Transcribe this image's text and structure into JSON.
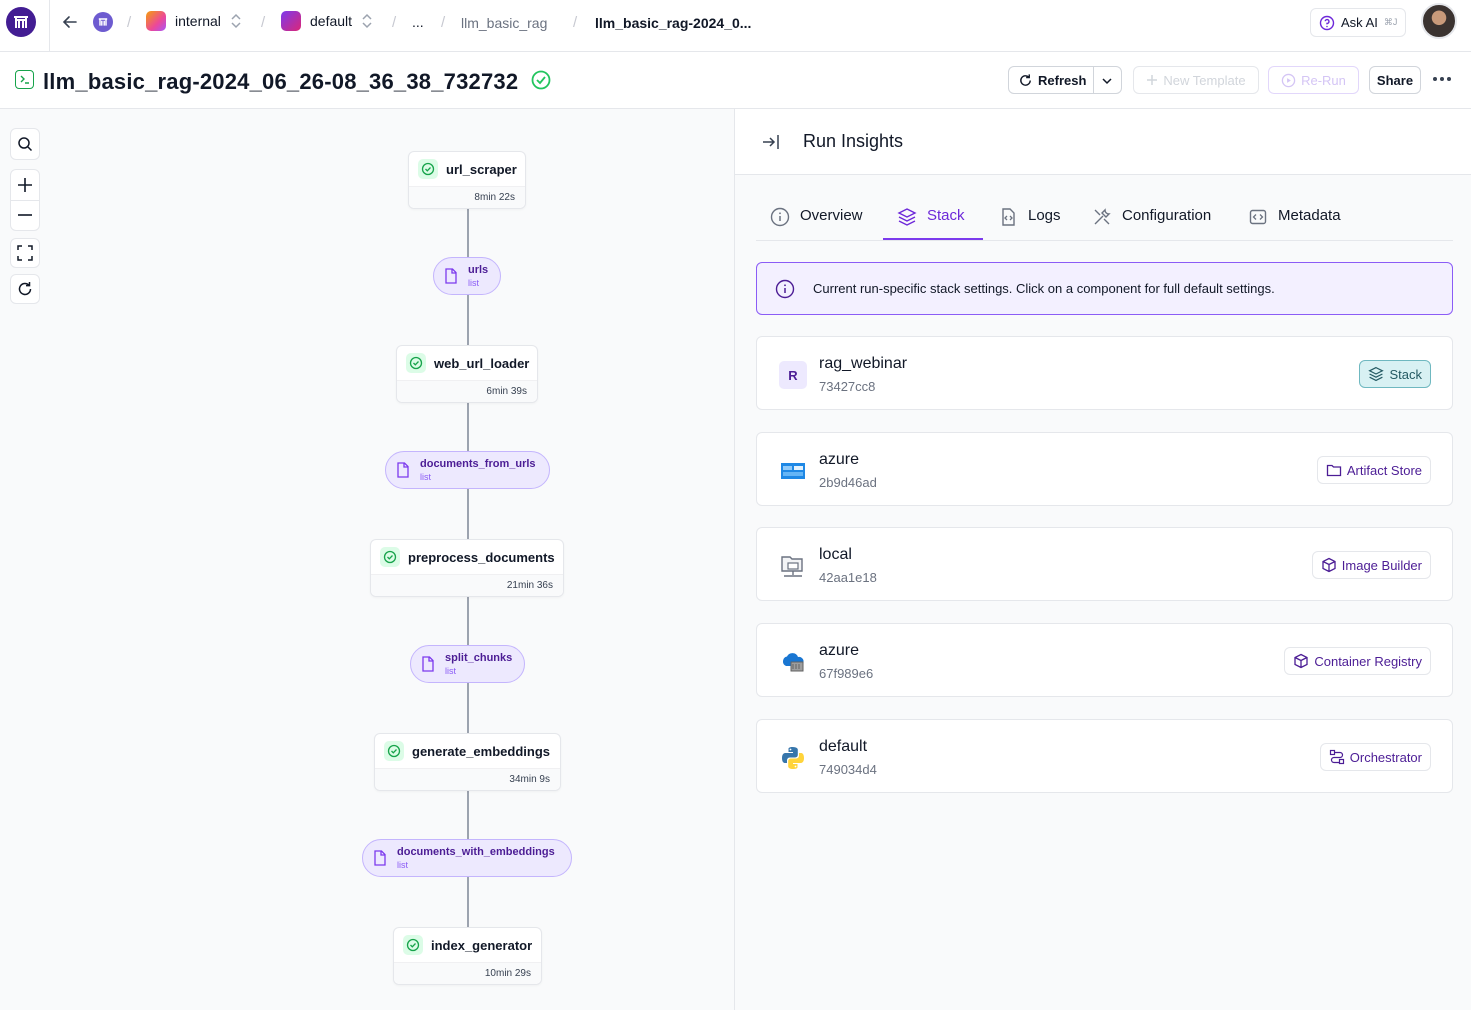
{
  "topbar": {
    "breadcrumbs": {
      "workspace": "internal",
      "project": "default",
      "ellipsis": "...",
      "pipeline": "llm_basic_rag",
      "run": "llm_basic_rag-2024_0..."
    },
    "ask_ai": {
      "label": "Ask AI",
      "shortcut": "⌘J"
    }
  },
  "header": {
    "run_name": "llm_basic_rag-2024_06_26-08_36_38_732732",
    "status": "completed",
    "refresh_label": "Refresh",
    "new_template_label": "New Template",
    "rerun_label": "Re-Run",
    "share_label": "Share"
  },
  "dag": {
    "steps": [
      {
        "name": "url_scraper",
        "duration": "8min 22s"
      },
      {
        "name": "web_url_loader",
        "duration": "6min 39s"
      },
      {
        "name": "preprocess_documents",
        "duration": "21min 36s"
      },
      {
        "name": "generate_embeddings",
        "duration": "34min 9s"
      },
      {
        "name": "index_generator",
        "duration": "10min 29s"
      }
    ],
    "artifacts": [
      {
        "name": "urls",
        "type": "list"
      },
      {
        "name": "documents_from_urls",
        "type": "list"
      },
      {
        "name": "split_chunks",
        "type": "list"
      },
      {
        "name": "documents_with_embeddings",
        "type": "list"
      }
    ]
  },
  "insights": {
    "title": "Run Insights",
    "tabs": [
      {
        "label": "Overview",
        "icon": "info-icon"
      },
      {
        "label": "Stack",
        "icon": "layers-icon",
        "active": true
      },
      {
        "label": "Logs",
        "icon": "logs-icon"
      },
      {
        "label": "Configuration",
        "icon": "tools-icon"
      },
      {
        "label": "Metadata",
        "icon": "code-icon"
      }
    ],
    "info_text": "Current run-specific stack settings. Click on a component for full default settings.",
    "stack": {
      "initial": "R",
      "name": "rag_webinar",
      "id": "73427cc8",
      "type": "Stack"
    },
    "components": [
      {
        "name": "azure",
        "id": "2b9d46ad",
        "type": "Artifact Store",
        "icon": "azure-storage-icon"
      },
      {
        "name": "local",
        "id": "42aa1e18",
        "type": "Image Builder",
        "icon": "local-folder-icon"
      },
      {
        "name": "azure",
        "id": "67f989e6",
        "type": "Container Registry",
        "icon": "azure-cloud-icon"
      },
      {
        "name": "default",
        "id": "749034d4",
        "type": "Orchestrator",
        "icon": "python-icon"
      }
    ]
  }
}
